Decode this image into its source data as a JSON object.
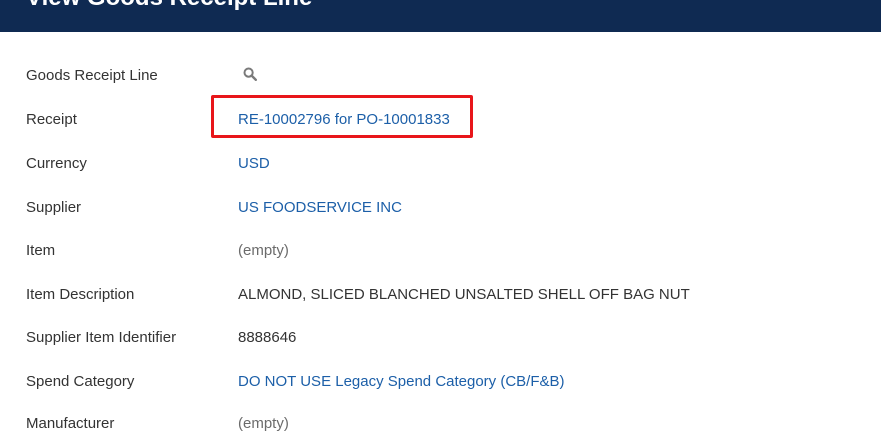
{
  "header": {
    "title": "View Goods Receipt Line"
  },
  "fields": [
    {
      "label": "Goods Receipt Line",
      "value": "",
      "type": "search"
    },
    {
      "label": "Receipt",
      "value": "RE-10002796 for PO-10001833",
      "type": "link"
    },
    {
      "label": "Currency",
      "value": "USD",
      "type": "link"
    },
    {
      "label": "Supplier",
      "value": "US FOODSERVICE INC",
      "type": "link"
    },
    {
      "label": "Item",
      "value": "(empty)",
      "type": "empty"
    },
    {
      "label": "Item Description",
      "value": "ALMOND, SLICED BLANCHED UNSALTED SHELL OFF BAG NUT",
      "type": "text"
    },
    {
      "label": "Supplier Item Identifier",
      "value": "8888646",
      "type": "text"
    },
    {
      "label": "Spend Category",
      "value": "DO NOT USE Legacy Spend Category (CB/F&B)",
      "type": "link"
    },
    {
      "label": "Manufacturer",
      "value": "(empty)",
      "type": "empty"
    }
  ],
  "icons": {
    "goods_receipt_line": "search-icon"
  },
  "colors": {
    "header_bg": "#0f2a52",
    "link": "#1c5fa8",
    "highlight": "#e8161a"
  }
}
